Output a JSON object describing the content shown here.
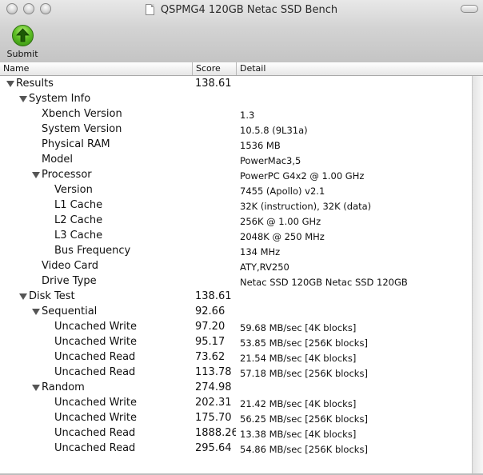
{
  "window": {
    "title": "QSPMG4 120GB Netac SSD Bench"
  },
  "toolbar": {
    "submit_label": "Submit"
  },
  "columns": {
    "name": "Name",
    "score": "Score",
    "detail": "Detail"
  },
  "rows": [
    {
      "name": "Results",
      "score": "138.61",
      "detail": "",
      "level": 0,
      "expanded": true
    },
    {
      "name": "System Info",
      "score": "",
      "detail": "",
      "level": 1,
      "expanded": true
    },
    {
      "name": "Xbench Version",
      "score": "",
      "detail": "1.3",
      "level": 2
    },
    {
      "name": "System Version",
      "score": "",
      "detail": "10.5.8 (9L31a)",
      "level": 2
    },
    {
      "name": "Physical RAM",
      "score": "",
      "detail": "1536 MB",
      "level": 2
    },
    {
      "name": "Model",
      "score": "",
      "detail": "PowerMac3,5",
      "level": 2
    },
    {
      "name": "Processor",
      "score": "",
      "detail": "PowerPC G4x2 @ 1.00 GHz",
      "level": 2,
      "expanded": true
    },
    {
      "name": "Version",
      "score": "",
      "detail": "7455 (Apollo) v2.1",
      "level": 3
    },
    {
      "name": "L1 Cache",
      "score": "",
      "detail": "32K (instruction), 32K (data)",
      "level": 3
    },
    {
      "name": "L2 Cache",
      "score": "",
      "detail": "256K @ 1.00 GHz",
      "level": 3
    },
    {
      "name": "L3 Cache",
      "score": "",
      "detail": "2048K @ 250 MHz",
      "level": 3
    },
    {
      "name": "Bus Frequency",
      "score": "",
      "detail": "134 MHz",
      "level": 3
    },
    {
      "name": "Video Card",
      "score": "",
      "detail": "ATY,RV250",
      "level": 2
    },
    {
      "name": "Drive Type",
      "score": "",
      "detail": "Netac SSD 120GB Netac SSD 120GB",
      "level": 2
    },
    {
      "name": "Disk Test",
      "score": "138.61",
      "detail": "",
      "level": 1,
      "expanded": true
    },
    {
      "name": "Sequential",
      "score": "92.66",
      "detail": "",
      "level": 2,
      "expanded": true
    },
    {
      "name": "Uncached Write",
      "score": "97.20",
      "detail": "59.68 MB/sec [4K blocks]",
      "level": 3
    },
    {
      "name": "Uncached Write",
      "score": "95.17",
      "detail": "53.85 MB/sec [256K blocks]",
      "level": 3
    },
    {
      "name": "Uncached Read",
      "score": "73.62",
      "detail": "21.54 MB/sec [4K blocks]",
      "level": 3
    },
    {
      "name": "Uncached Read",
      "score": "113.78",
      "detail": "57.18 MB/sec [256K blocks]",
      "level": 3
    },
    {
      "name": "Random",
      "score": "274.98",
      "detail": "",
      "level": 2,
      "expanded": true
    },
    {
      "name": "Uncached Write",
      "score": "202.31",
      "detail": "21.42 MB/sec [4K blocks]",
      "level": 3
    },
    {
      "name": "Uncached Write",
      "score": "175.70",
      "detail": "56.25 MB/sec [256K blocks]",
      "level": 3
    },
    {
      "name": "Uncached Read",
      "score": "1888.26",
      "detail": "13.38 MB/sec [4K blocks]",
      "level": 3
    },
    {
      "name": "Uncached Read",
      "score": "295.64",
      "detail": "54.86 MB/sec [256K blocks]",
      "level": 3
    }
  ]
}
